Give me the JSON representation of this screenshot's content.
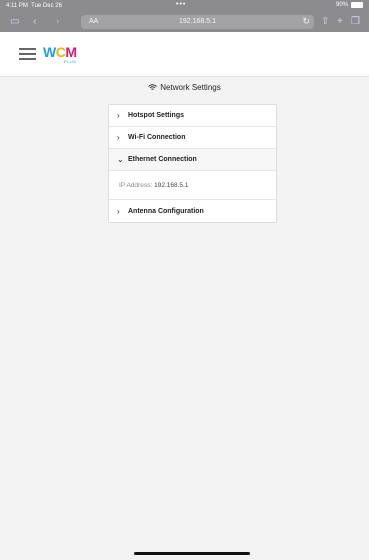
{
  "status": {
    "time": "4:11 PM",
    "date": "Tue Dec 26",
    "dots": "•••",
    "battery": "90%"
  },
  "browser": {
    "text_size_label": "AA",
    "url": "192.168.5.1"
  },
  "brand": {
    "logo_w": "W",
    "logo_c": "C",
    "logo_m": "M",
    "logo_sub": "PLUS"
  },
  "page": {
    "title": "Network Settings"
  },
  "sections": [
    {
      "label": "Hotspot Settings",
      "chevron": "›"
    },
    {
      "label": "Wi-Fi Connection",
      "chevron": "›"
    },
    {
      "label": "Ethernet Connection",
      "chevron": "⌄"
    },
    {
      "label": "Antenna Configuration",
      "chevron": "›"
    }
  ],
  "ethernet": {
    "ip_label": "IP Address:",
    "ip_value": "192.168.5.1"
  }
}
